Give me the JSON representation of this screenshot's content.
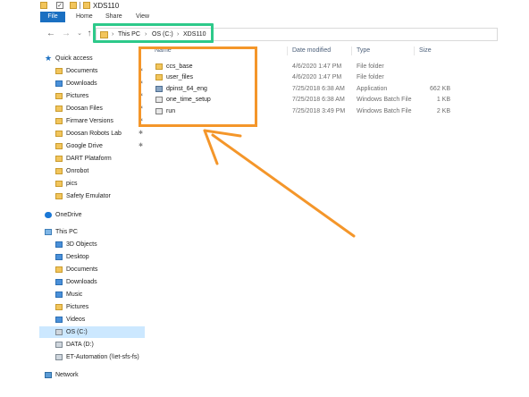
{
  "window": {
    "title": "XDS110"
  },
  "ribbon": {
    "tabs": [
      "File",
      "Home",
      "Share",
      "View"
    ]
  },
  "address": {
    "crumbs": [
      "This PC",
      "OS (C:)",
      "XDS110"
    ],
    "separator": "›",
    "recent_glyph": "⌄"
  },
  "columns": [
    "Name",
    "Date modified",
    "Type",
    "Size"
  ],
  "files": [
    {
      "name": "ccs_base",
      "date": "4/6/2020 1:47 PM",
      "type": "File folder",
      "size": "",
      "icon": "folder-icon"
    },
    {
      "name": "user_files",
      "date": "4/6/2020 1:47 PM",
      "type": "File folder",
      "size": "",
      "icon": "folder-icon"
    },
    {
      "name": "dpinst_64_eng",
      "date": "7/25/2018 6:38 AM",
      "type": "Application",
      "size": "662 KB",
      "icon": "application-icon"
    },
    {
      "name": "one_time_setup",
      "date": "7/25/2018 6:38 AM",
      "type": "Windows Batch File",
      "size": "1 KB",
      "icon": "batch-file-icon"
    },
    {
      "name": "run",
      "date": "7/25/2018 3:49 PM",
      "type": "Windows Batch File",
      "size": "2 KB",
      "icon": "batch-file-icon"
    }
  ],
  "nav": {
    "quick_access": "Quick access",
    "quick_items": [
      "Documents",
      "Downloads",
      "Pictures",
      "Doosan Files",
      "Firmare Versions",
      "Doosan Robots Lab",
      "Google Drive",
      "DART Plataform",
      "Onrobot",
      "pics",
      "Safety Emulator"
    ],
    "onedrive": "OneDrive",
    "this_pc": "This PC",
    "pc_items": [
      "3D Objects",
      "Desktop",
      "Documents",
      "Downloads",
      "Music",
      "Pictures",
      "Videos",
      "OS (C:)",
      "DATA (D:)",
      "ET-Automation (\\\\et-sfs-fs)"
    ],
    "network": "Network",
    "selected": "OS (C:)"
  },
  "colors": {
    "accent": "#1a6fc1",
    "selection": "#cce8ff",
    "highlight_green": "#2dc98a",
    "highlight_orange": "#f4962a",
    "folder": "#f2c55c"
  }
}
